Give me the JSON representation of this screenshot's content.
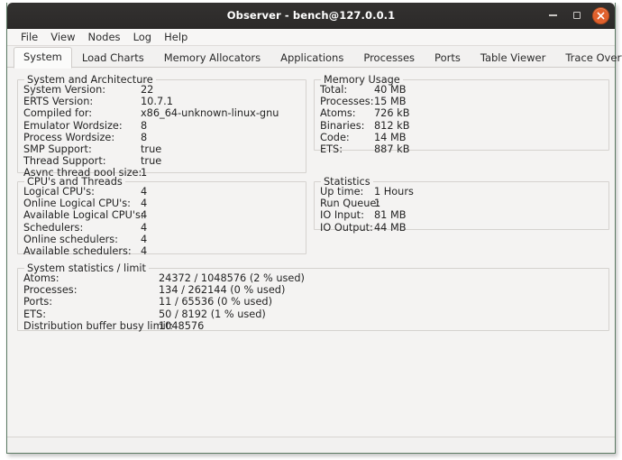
{
  "window": {
    "title": "Observer - bench@127.0.0.1",
    "controls": {
      "minimize_label": "Minimize",
      "maximize_label": "Maximize",
      "close_label": "Close"
    },
    "accent_close_color": "#e0602c",
    "titlebar_color": "#2f2d2c"
  },
  "menubar": {
    "items": [
      {
        "label": "File"
      },
      {
        "label": "View"
      },
      {
        "label": "Nodes"
      },
      {
        "label": "Log"
      },
      {
        "label": "Help"
      }
    ]
  },
  "tabs": {
    "active": "System",
    "items": [
      {
        "label": "System"
      },
      {
        "label": "Load Charts"
      },
      {
        "label": "Memory Allocators"
      },
      {
        "label": "Applications"
      },
      {
        "label": "Processes"
      },
      {
        "label": "Ports"
      },
      {
        "label": "Table Viewer"
      },
      {
        "label": "Trace Overview"
      }
    ]
  },
  "panels": {
    "system_architecture": {
      "legend": "System and Architecture",
      "rows": [
        {
          "key": "System Version:",
          "value": "22"
        },
        {
          "key": "ERTS Version:",
          "value": "10.7.1"
        },
        {
          "key": "Compiled for:",
          "value": "x86_64-unknown-linux-gnu"
        },
        {
          "key": "Emulator Wordsize:",
          "value": "8"
        },
        {
          "key": "Process Wordsize:",
          "value": "8"
        },
        {
          "key": "SMP Support:",
          "value": "true"
        },
        {
          "key": "Thread Support:",
          "value": "true"
        },
        {
          "key": "Async thread pool size:",
          "value": "1"
        }
      ]
    },
    "memory_usage": {
      "legend": "Memory Usage",
      "rows": [
        {
          "key": "Total:",
          "value": "40 MB"
        },
        {
          "key": "Processes:",
          "value": "15 MB"
        },
        {
          "key": "Atoms:",
          "value": "726 kB"
        },
        {
          "key": "Binaries:",
          "value": "812 kB"
        },
        {
          "key": "Code:",
          "value": "14 MB"
        },
        {
          "key": "ETS:",
          "value": "887 kB"
        }
      ]
    },
    "cpus_threads": {
      "legend": "CPU's and Threads",
      "rows": [
        {
          "key": "Logical CPU's:",
          "value": "4"
        },
        {
          "key": "Online Logical CPU's:",
          "value": "4"
        },
        {
          "key": "Available Logical CPU's:",
          "value": "4"
        },
        {
          "key": "Schedulers:",
          "value": "4"
        },
        {
          "key": "Online schedulers:",
          "value": "4"
        },
        {
          "key": "Available schedulers:",
          "value": "4"
        }
      ]
    },
    "statistics": {
      "legend": "Statistics",
      "rows": [
        {
          "key": "Up time:",
          "value": "1 Hours"
        },
        {
          "key": "Run Queue:",
          "value": "1"
        },
        {
          "key": "IO Input:",
          "value": "81 MB"
        },
        {
          "key": "IO Output:",
          "value": "44 MB"
        }
      ]
    },
    "system_statistics_limit": {
      "legend": "System statistics / limit",
      "rows": [
        {
          "key": "Atoms:",
          "value": "24372 / 1048576 (2 % used)"
        },
        {
          "key": "Processes:",
          "value": "134 / 262144 (0 % used)"
        },
        {
          "key": "Ports:",
          "value": "11 / 65536 (0 % used)"
        },
        {
          "key": "ETS:",
          "value": "50 / 8192 (1 % used)"
        },
        {
          "key": "Distribution buffer busy limit:",
          "value": "1048576"
        }
      ]
    }
  },
  "statusbar": {
    "text": ""
  }
}
